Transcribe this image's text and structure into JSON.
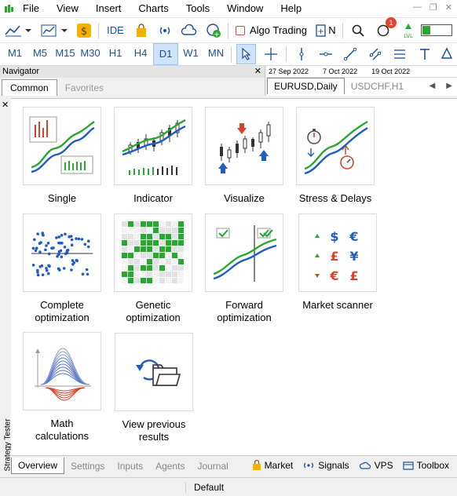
{
  "menu": [
    "File",
    "View",
    "Insert",
    "Charts",
    "Tools",
    "Window",
    "Help"
  ],
  "toolbar": {
    "ide_label": "IDE",
    "algo_label": "Algo Trading",
    "new_order_label": "N",
    "notification_count": "1",
    "battery_level": 0.28,
    "timeframes": [
      "M1",
      "M5",
      "M15",
      "M30",
      "H1",
      "H4",
      "D1",
      "W1",
      "MN"
    ],
    "active_timeframe": "D1"
  },
  "navigator": {
    "title": "Navigator",
    "tabs": [
      "Common",
      "Favorites"
    ],
    "active_tab": "Common"
  },
  "chart_header": {
    "dates": [
      "27 Sep 2022",
      "7 Oct 2022",
      "19 Oct 2022"
    ],
    "tabs": [
      "EURUSD,Daily",
      "USDCHF,H1"
    ]
  },
  "tester": {
    "side_label": "Strategy Tester",
    "tiles": [
      {
        "label": "Single"
      },
      {
        "label": "Indicator"
      },
      {
        "label": "Visualize"
      },
      {
        "label": "Stress & Delays"
      },
      {
        "label": "Complete\noptimization"
      },
      {
        "label": "Genetic\noptimization"
      },
      {
        "label": "Forward\noptimization"
      },
      {
        "label": "Market scanner"
      },
      {
        "label": "Math\ncalculations"
      },
      {
        "label": "View previous\nresults"
      }
    ]
  },
  "bottom_tabs": [
    "Overview",
    "Settings",
    "Inputs",
    "Agents",
    "Journal"
  ],
  "bottom_right": [
    "Market",
    "Signals",
    "VPS",
    "Toolbox"
  ],
  "status": {
    "profile": "Default"
  },
  "colors": {
    "accent": "#1a4f9c",
    "green": "#2aa730",
    "blue_line": "#1f5cc4",
    "red": "#d9412b"
  }
}
